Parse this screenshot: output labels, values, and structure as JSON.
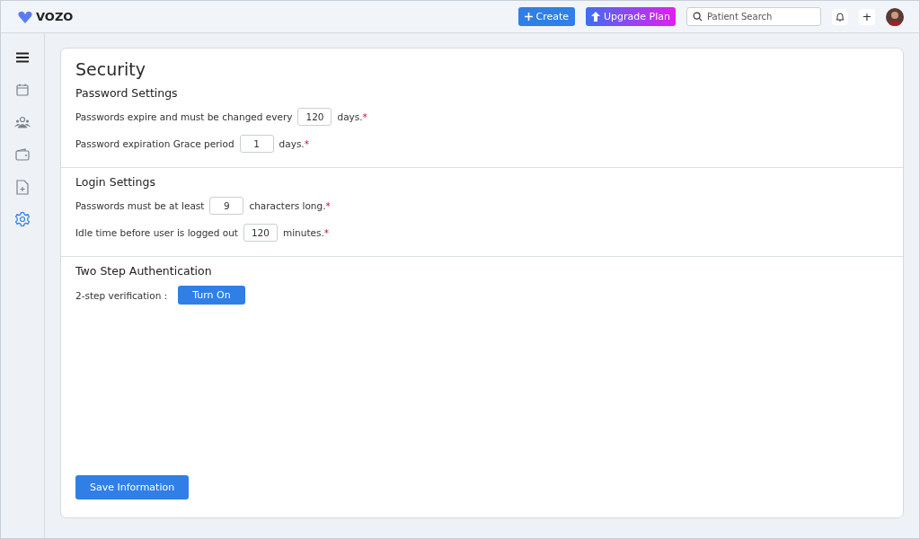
{
  "topbar": {
    "logo": "VOZO",
    "create_button": "Create",
    "upgrade_button": "Upgrade Plan",
    "search": {
      "placeholder": "Patient Search"
    },
    "add_button": "+"
  },
  "sidebar": {
    "items": [
      {
        "kind": "calendar",
        "selected": false
      },
      {
        "kind": "people",
        "selected": false
      },
      {
        "kind": "wallet",
        "selected": false
      },
      {
        "kind": "file",
        "selected": false
      },
      {
        "kind": "settings",
        "selected": true
      }
    ]
  },
  "page": {
    "title": "Security",
    "sections": [
      {
        "title": "Password Settings",
        "rows": [
          {
            "label": "Passwords expire and must be changed every",
            "value": "120",
            "suffix": "days.",
            "mark": "*"
          },
          {
            "label": "Password expiration Grace period",
            "value": "1",
            "suffix": "days.",
            "mark": "*"
          }
        ]
      },
      {
        "title": "Login Settings",
        "rows": [
          {
            "label": "Passwords must be at least",
            "value": "9",
            "suffix": "characters long.",
            "mark": "*"
          },
          {
            "label": "Idle time before user is logged out",
            "value": "120",
            "suffix": "minutes.",
            "mark": "*"
          }
        ]
      },
      {
        "title": "Two Step Authentication",
        "verification": {
          "label": "2-step verification :",
          "button": "Turn On"
        }
      }
    ],
    "save_button": "Save Information"
  }
}
